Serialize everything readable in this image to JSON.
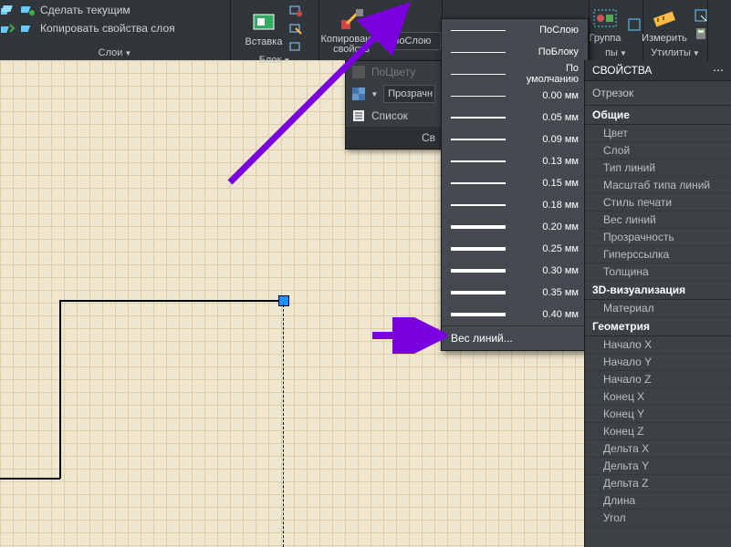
{
  "ribbon": {
    "layers": {
      "make_current": "Сделать текущим",
      "copy_props": "Копировать свойства слоя",
      "label": "Слои"
    },
    "block": {
      "insert": "Вставка",
      "label": "Блок"
    },
    "copy_props": {
      "label": "Копирование свойств"
    },
    "lineweight_combo": "ПоСлою",
    "group": {
      "label": "Группа"
    },
    "groups_label": "пы",
    "measure": {
      "label": "Измерить"
    },
    "utils": {
      "label": "Утилиты"
    }
  },
  "flyout": {
    "bycolor": "ПоЦвету",
    "transparency": "Прозрачн",
    "list": "Список",
    "footer": "Св"
  },
  "lineweights": {
    "by_layer": "ПоСлою",
    "by_block": "ПоБлоку",
    "default": "По умолчанию",
    "values": [
      "0.00 мм",
      "0.05 мм",
      "0.09 мм",
      "0.13 мм",
      "0.15 мм",
      "0.18 мм",
      "0.20 мм",
      "0.25 мм",
      "0.30 мм",
      "0.35 мм",
      "0.40 мм"
    ],
    "more": "Вес линий..."
  },
  "properties": {
    "title": "СВОЙСТВА",
    "obj": "Отрезок",
    "sections": [
      {
        "hdr": "Общие",
        "rows": [
          "Цвет",
          "Слой",
          "Тип линий",
          "Масштаб типа линий",
          "Стиль печати",
          "Вес линий",
          "Прозрачность",
          "Гиперссылка",
          "Толщина"
        ]
      },
      {
        "hdr": "3D-визуализация",
        "rows": [
          "Материал"
        ]
      },
      {
        "hdr": "Геометрия",
        "rows": [
          "Начало X",
          "Начало Y",
          "Начало Z",
          "Конец X",
          "Конец Y",
          "Конец Z",
          "Дельта X",
          "Дельта Y",
          "Дельта Z",
          "Длина",
          "Угол"
        ]
      }
    ]
  }
}
